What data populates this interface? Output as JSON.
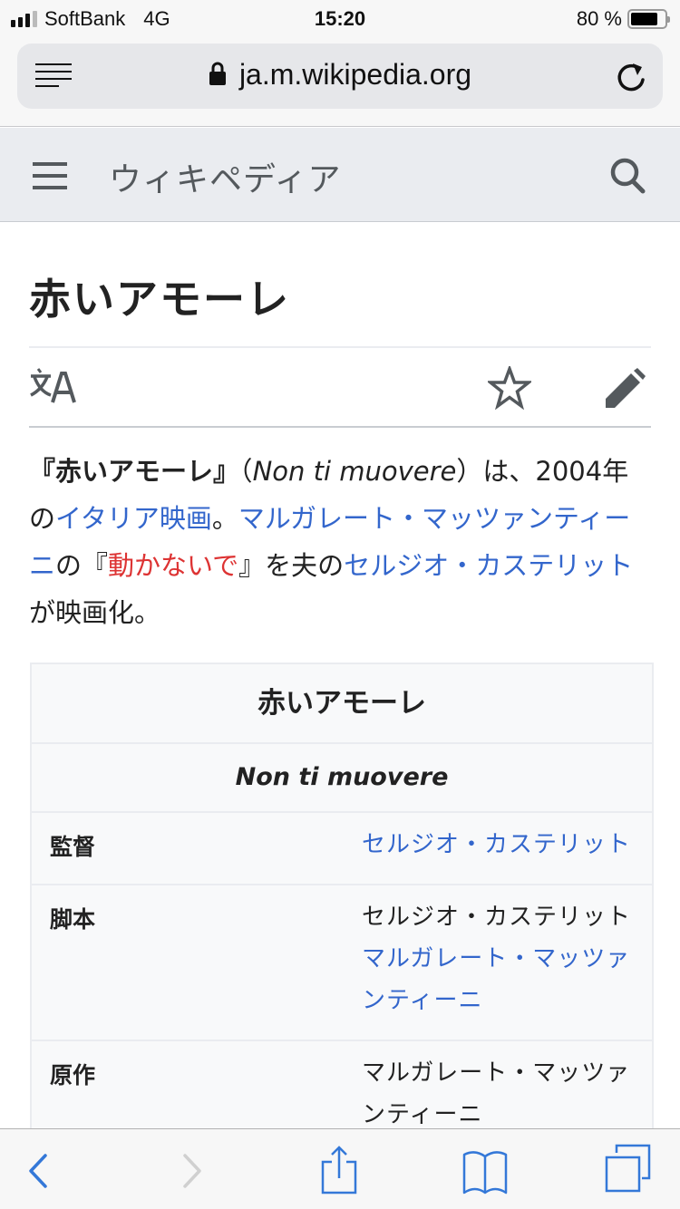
{
  "status_bar": {
    "carrier": "SoftBank",
    "network": "4G",
    "time": "15:20",
    "battery_text": "80 %",
    "battery_level": 0.8,
    "signal_bars": 3,
    "signal_bars_total": 4
  },
  "browser": {
    "url": "ja.m.wikipedia.org",
    "reader_icon": "reader-mode-icon",
    "lock_icon": "lock-icon",
    "reload_icon": "reload-icon"
  },
  "wiki_header": {
    "logo_text": "ウィキペディア",
    "menu_icon": "hamburger-menu-icon",
    "search_icon": "search-icon"
  },
  "article": {
    "title": "赤いアモーレ",
    "actions": {
      "language_icon": "language-icon",
      "watch_icon": "star-icon",
      "edit_icon": "pencil-icon"
    },
    "lead": {
      "open_bracket": "『",
      "bold_title": "赤いアモーレ",
      "close_bracket": "』",
      "paren_open": "（",
      "italic_title": "Non ti muovere",
      "paren_close": "）",
      "text1": "は、2004年の",
      "link_italy_film": "イタリア映画",
      "text2": "。",
      "link_author": "マルガレート・マッツァンティーニ",
      "text3": "の『",
      "link_novel": "動かないで",
      "text4": "』を夫の",
      "link_director": "セルジオ・カステリット",
      "text5": "が映画化。"
    },
    "infobox": {
      "title": "赤いアモーレ",
      "subtitle": "Non ti muovere",
      "rows": [
        {
          "label": "監督",
          "values": [
            {
              "text": "セルジオ・カステリット",
              "link": true
            }
          ]
        },
        {
          "label": "脚本",
          "values": [
            {
              "text": "セルジオ・カステリット",
              "link": false
            },
            {
              "text": "マルガレート・マッツァ",
              "link": true
            },
            {
              "text": "ンティーニ",
              "link": true
            }
          ]
        },
        {
          "label": "原作",
          "values": [
            {
              "text": "マルガレート・マッツァ",
              "link": false
            },
            {
              "text": "ンティーニ",
              "link": false
            }
          ]
        }
      ]
    }
  },
  "toolbar": {
    "back_icon": "back-chevron-icon",
    "forward_icon": "forward-chevron-icon",
    "share_icon": "share-icon",
    "bookmarks_icon": "bookmarks-icon",
    "tabs_icon": "tabs-icon"
  },
  "colors": {
    "link": "#3366cc",
    "new_link": "#dd3333",
    "ios_accent": "#3478d8",
    "header_bg": "#eaecf0"
  }
}
